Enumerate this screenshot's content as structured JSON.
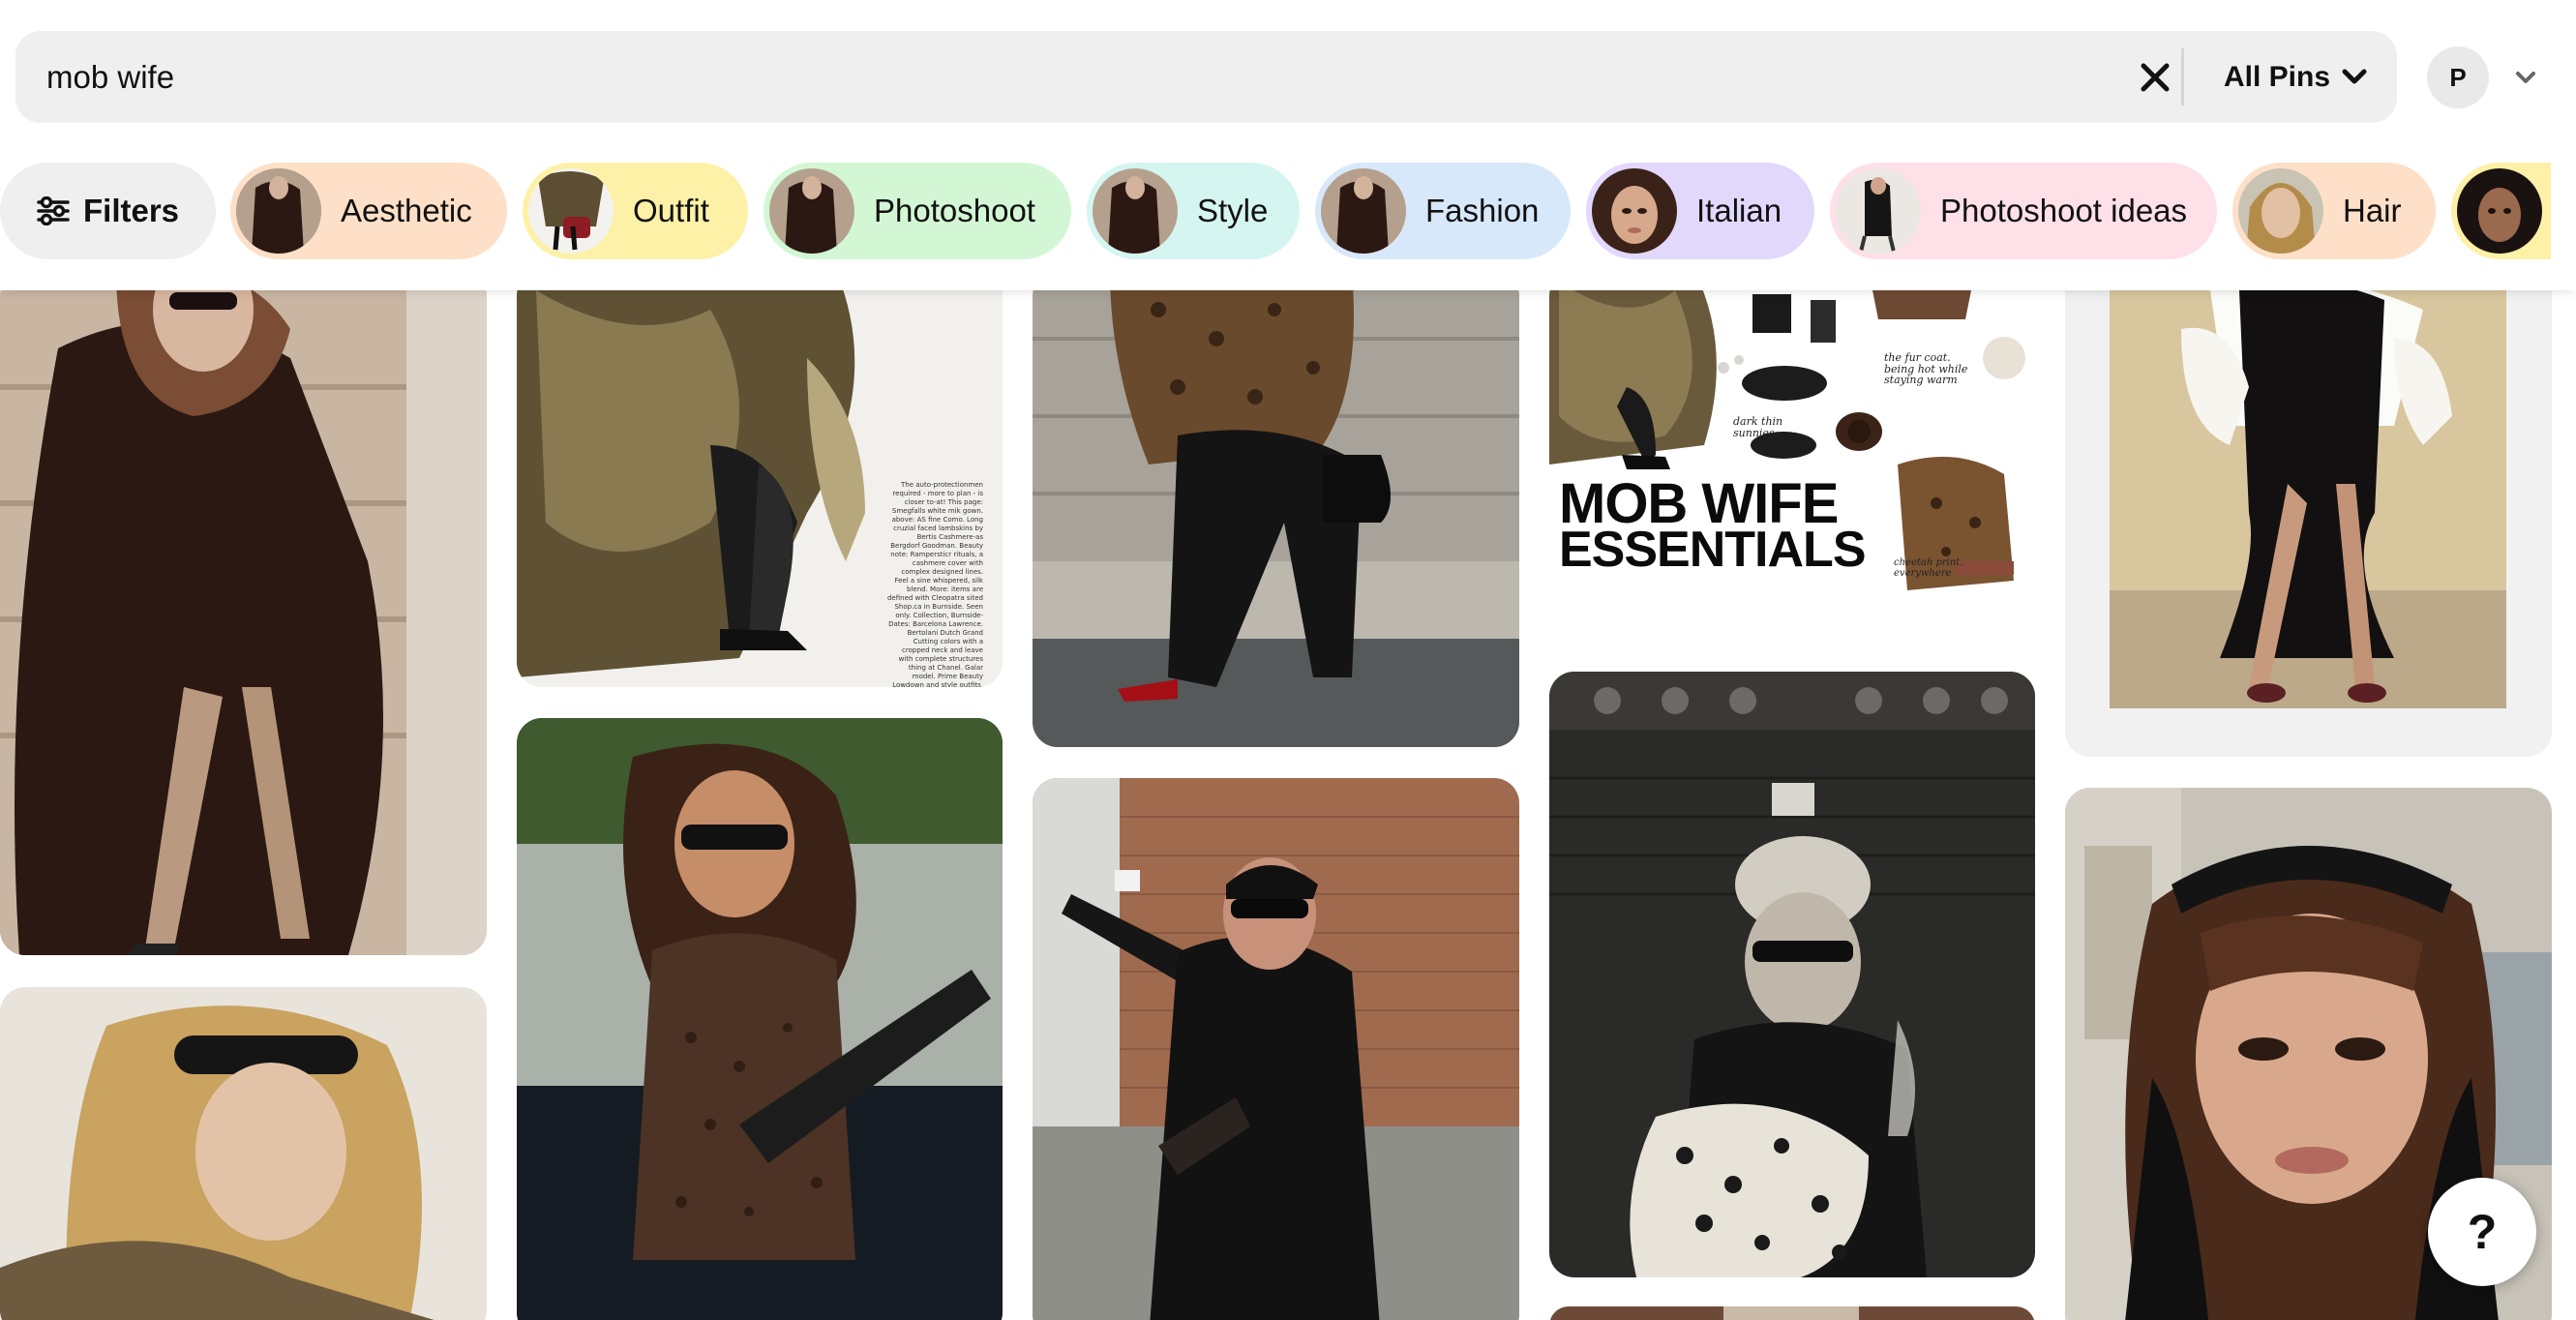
{
  "search": {
    "value": "mob wife",
    "clear_icon": "close-icon",
    "scope_label": "All Pins",
    "scope_icon": "chevron-down-icon"
  },
  "account": {
    "avatar_initial": "P",
    "menu_icon": "chevron-down-icon"
  },
  "filters": {
    "label": "Filters",
    "icon": "sliders-icon"
  },
  "chips": [
    {
      "label": "Aesthetic",
      "color": "#fde0c7"
    },
    {
      "label": "Outfit",
      "color": "#fdf1a8"
    },
    {
      "label": "Photoshoot",
      "color": "#d3f7d5"
    },
    {
      "label": "Style",
      "color": "#d5f5f1"
    },
    {
      "label": "Fashion",
      "color": "#d8e8fb"
    },
    {
      "label": "Italian",
      "color": "#e2d8fb"
    },
    {
      "label": "Photoshoot ideas",
      "color": "#fde0e8"
    },
    {
      "label": "Hair",
      "color": "#fde0c7"
    },
    {
      "label": "",
      "color": "#fdf1a8"
    }
  ],
  "pins": {
    "essentials_title_line1": "MOB WIFE",
    "essentials_title_line2": "ESSENTIALS",
    "essentials_note_coat": "the fur coat. being hot while staying warm",
    "essentials_note_sunnies": "dark thin sunnies.",
    "essentials_note_cheetah": "cheetah print. everywhere",
    "magazine_caption": "The auto-protectionmen required - more to plan - is closer to-at! This page: Smegfalls white mik gown. above: AS fine Como. Long cruzial faced lambskins by Bertis Cashmere-as Bergdorf Goodman. Beauty note: Rampersticr rituals, a cashmere cover with complex designed lines. Feel a sine whispered, silk blend. More: items are defined with Cleopatra sited Shop.ca in Burnside. Seen only. Collection, Burnside-Dates: Barcelona Lawrence. Bertolani Dutch Grand Cutting colors with a cropped neck and leave with complete structures thing at Chanel. Galar model. Prime Beauty Lowdown and style outfits."
  },
  "help": {
    "label": "?"
  },
  "colors": {
    "search_bg": "#efefef",
    "page_bg": "#ffffff",
    "text": "#111111"
  }
}
